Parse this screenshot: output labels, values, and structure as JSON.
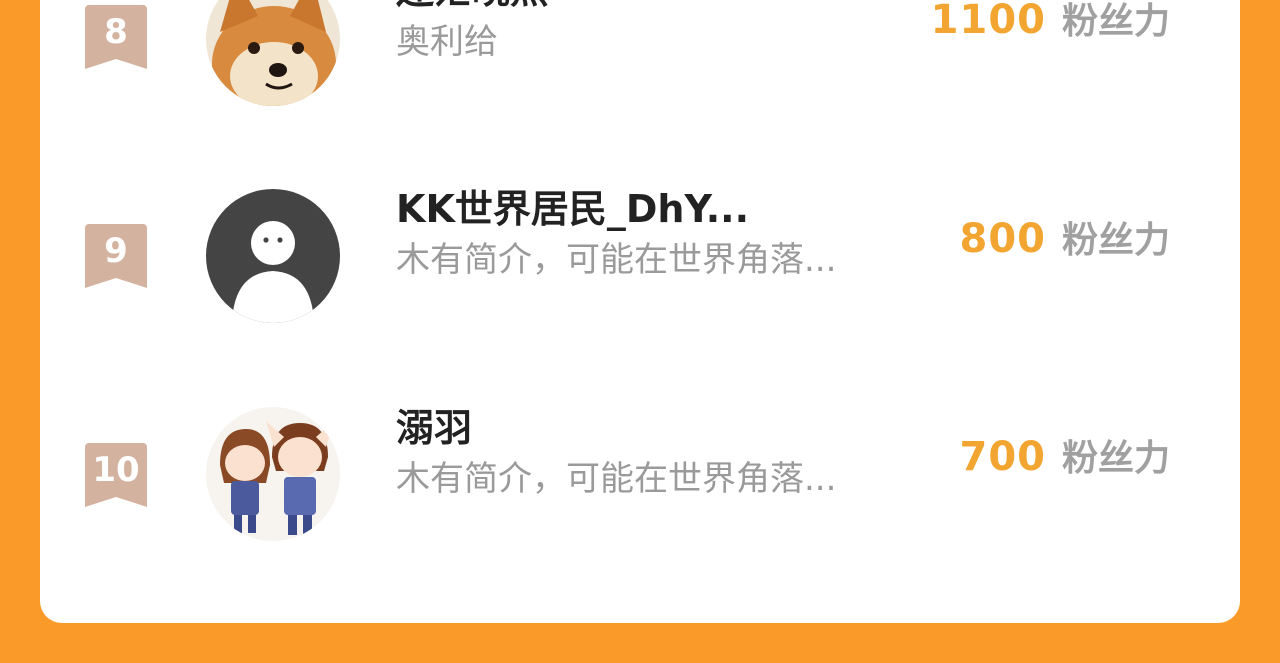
{
  "colors": {
    "background": "#fa9a28",
    "card": "#ffffff",
    "badge": "#d4b2a0",
    "score": "#f2a531",
    "unit": "#a0a0a0"
  },
  "leaderboard": {
    "entries": [
      {
        "rank": "8",
        "name": "迷茫晓熙",
        "bio": "奥利给",
        "score": "1100",
        "unit": "粉丝力",
        "avatar_icon": "shiba-dog-avatar"
      },
      {
        "rank": "9",
        "name": "KK世界居民_DhY...",
        "bio": "木有简介，可能在世界角落...",
        "score": "800",
        "unit": "粉丝力",
        "avatar_icon": "default-user-avatar"
      },
      {
        "rank": "10",
        "name": "溺羽",
        "bio": "木有简介，可能在世界角落...",
        "score": "700",
        "unit": "粉丝力",
        "avatar_icon": "anime-couple-avatar"
      }
    ]
  }
}
